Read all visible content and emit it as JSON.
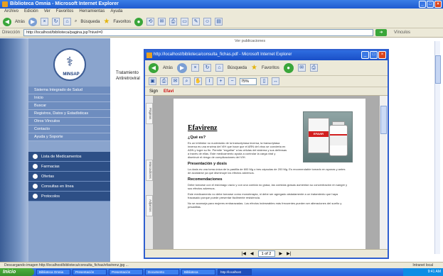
{
  "window": {
    "title": "Biblioteca Omnia - Microsoft Internet Explorer"
  },
  "menubar": {
    "items": [
      "Archivo",
      "Edición",
      "Ver",
      "Favoritos",
      "Herramientas",
      "Ayuda"
    ]
  },
  "toolbar": {
    "back_label": "Atrás",
    "search_label": "Búsqueda",
    "favorites_label": "Favoritos"
  },
  "address": {
    "label": "Dirección",
    "url": "http://localhost/biblioteca/pagina.jsp?nivel=0",
    "right_text": "Vínculos"
  },
  "page": {
    "top_blurb": "Ver publicaciones",
    "blurb_line1": "Tratamiento",
    "blurb_line2": "Antiretroviral",
    "logo_text": "MINSAP",
    "nav_links": [
      "Sistema Integrado de Salud",
      "Inicio",
      "Buscar",
      "Registros, Datos y Estadísticas",
      "Otros Vínculos",
      "Contacto",
      "Ayuda y Soporte"
    ],
    "sub_items": [
      "Lista de Medicamentos",
      "Farmacias",
      "Ofertas",
      "Consultas en línea",
      "Protocolos"
    ]
  },
  "popup": {
    "title": "http://localhost/biblioteca/consulta_fichas.pdf - Microsoft Internet Explorer",
    "back_label": "Atrás",
    "search_label": "Búsqueda",
    "favorites_label": "Favoritos",
    "zoom": "75%",
    "tb3_sign": "Sign",
    "tb3_highlight": "Efavi",
    "tab_pages": "Páginas",
    "tab_bookmarks": "Marcadores",
    "tab_attach": "Adjuntos",
    "page_indicator": "1 of 2",
    "doc": {
      "title": "Efavirenz",
      "h_what": "¿Qué es?",
      "p_what": "Es un inhibidor no nucleósido de la transcriptasa inversa, la transcriptasa inversa es una enzima del VIH que hace que el ARN del virus se convierta en ADN y logre su fin. Permite \"engañar\" a las células del sistema y sus defensas a través de ellas. Este medicamento ayuda a controlar la carga viral y disminuir el riesgo de complicaciones del VIH.",
      "h_presentation": "Presentación y dosis",
      "p_presentation": "La dosis es una toma única de la pastilla de 600 Mg o tres cápsulas de 200 Mg. Es recomendable tomarlo en ayunas y antes de acostarse ya que disminuye los efectos adversos.",
      "h_recommendations": "Recomendaciones",
      "p_recommendations": "Debe tomarse con el estómago vacío y con una comida no grasa, las comidas grasas aumentan su concentración en sangre y sus efectos adversos.",
      "p_extra1": "Este medicamento no debe tomarse como monoterapia, ni debe ser agregado aisladamente a un tratamiento que haya fracasado porque puede presentar fácilmente resistencia.",
      "p_extra2": "No se aconseja para mujeres embarazadas. Los efectos indeseables más frecuentes pueden ser alteraciones del sueño y pesadillas.",
      "product_label": "EFAVIR",
      "product_dose": "600"
    }
  },
  "status": {
    "text": "Descargando imagen http://localhost/biblioteca/consulta_fichas/efavirenz.jpg ...",
    "zone": "Intranet local"
  },
  "taskbar": {
    "start_label": "Inicio",
    "tasks": [
      "Biblioteca Omnia",
      "Presentación",
      "Presentación",
      "Documento",
      "Biblioteca",
      "http://localhost"
    ],
    "clock": "9:41 AM"
  }
}
